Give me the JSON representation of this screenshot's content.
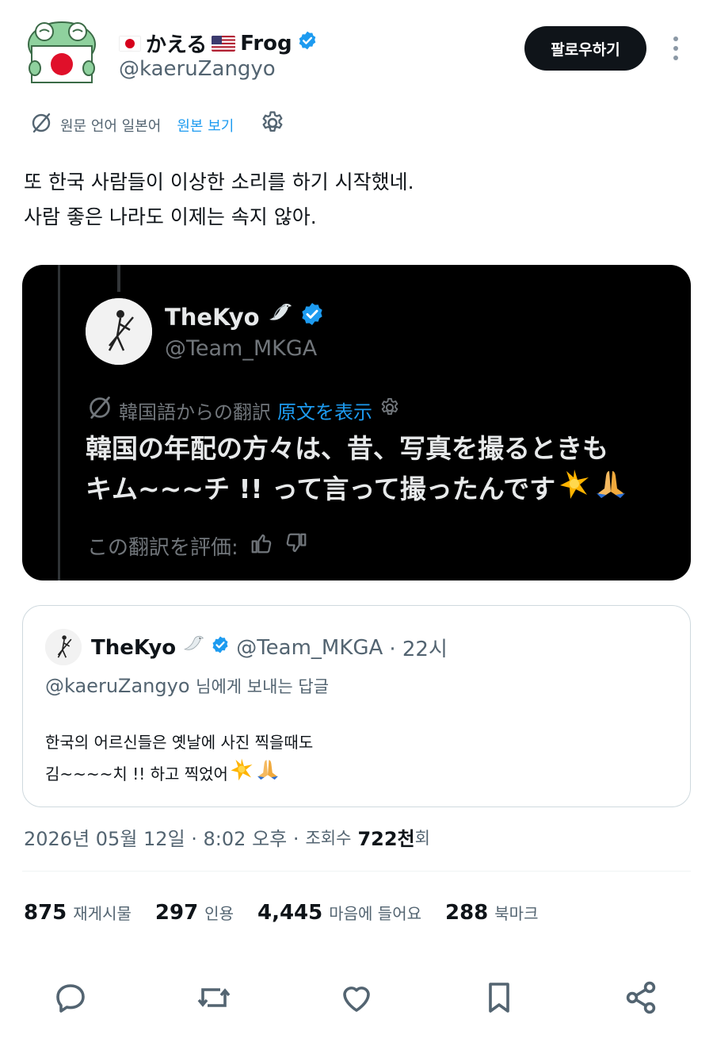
{
  "author": {
    "name_jp": "かえる",
    "name_en": "Frog",
    "handle": "@kaeruZangyo",
    "follow_label": "팔로우하기"
  },
  "translation_bar": {
    "source_text": "원문 언어 일본어",
    "show_original": "원본 보기"
  },
  "tweet": {
    "line1": "또 한국 사람들이 이상한 소리를 하기 시작했네.",
    "line2": "사람 좋은 나라도 이제는 속지 않아."
  },
  "media": {
    "name": "TheKyo",
    "handle": "@Team_MKGA",
    "translation_source": "韓国語からの翻訳",
    "show_original": "原文を表示",
    "line1": "韓国の年配の方々は、昔、写真を撮るときも",
    "line2": "キム~~~チ !! って言って撮ったんです",
    "rate_label": "この翻訳を評価:"
  },
  "quote": {
    "name": "TheKyo",
    "handle": "@Team_MKGA",
    "time": "· 22시",
    "reply_to_handle": "@kaeruZangyo",
    "reply_to_suffix": "님에게 보내는 답글",
    "line1": "한국의 어르신들은 옛날에 사진 찍을때도",
    "line2": "김~~~~치 !! 하고 찍었어"
  },
  "meta": {
    "datetime": "2026년 05월 12일 · 8:02 오후 ·",
    "views_label": "조회수",
    "views_num": "722천",
    "views_suffix": "회"
  },
  "stats": [
    {
      "num": "875",
      "label": "재게시물"
    },
    {
      "num": "297",
      "label": "인용"
    },
    {
      "num": "4,445",
      "label": "마음에 들어요"
    },
    {
      "num": "288",
      "label": "북마크"
    }
  ],
  "colors": {
    "accent": "#1d9bf0",
    "verified": "#1d9bf0",
    "text": "#0f1419",
    "muted": "#536471"
  },
  "icons": [
    "verified-badge-icon",
    "translate-icon",
    "gear-icon",
    "more-icon",
    "reply-icon",
    "repost-icon",
    "like-icon",
    "bookmark-icon",
    "share-icon",
    "thumbs-up-icon",
    "thumbs-down-icon",
    "sparkle-emoji",
    "praying-hands-emoji",
    "dove-emoji"
  ]
}
